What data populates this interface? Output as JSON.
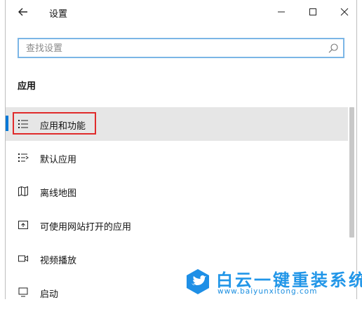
{
  "window": {
    "title": "设置"
  },
  "search": {
    "placeholder": "查找设置",
    "value": ""
  },
  "section_heading": "应用",
  "nav": {
    "items": [
      {
        "label": "应用和功能",
        "icon": "apps-list-icon",
        "active": true
      },
      {
        "label": "默认应用",
        "icon": "default-apps-icon"
      },
      {
        "label": "离线地图",
        "icon": "offline-maps-icon"
      },
      {
        "label": "可使用网站打开的应用",
        "icon": "apps-for-websites-icon"
      },
      {
        "label": "视频播放",
        "icon": "video-playback-icon"
      },
      {
        "label": "启动",
        "icon": "startup-icon"
      }
    ]
  },
  "watermark": {
    "title": "白云一键重装系统",
    "url": "www.baiyunxitong.com"
  },
  "colors": {
    "accent": "#0078d7",
    "highlight": "#e02b2b",
    "active_bg": "#e6e6e6",
    "search_border": "#7bb6e6",
    "watermark": "#2196e8"
  }
}
